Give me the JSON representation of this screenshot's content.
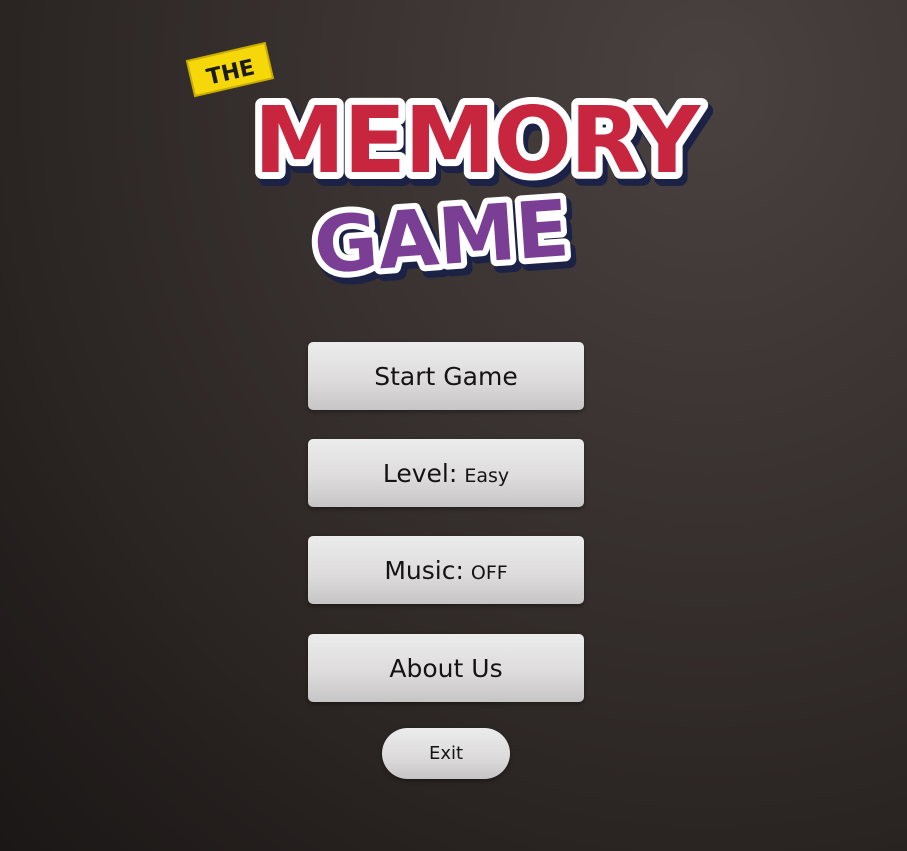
{
  "logo": {
    "the_text": "THE",
    "memory_text": "MEMORY",
    "game_text": "GAME"
  },
  "menu": {
    "start_label": "Start Game",
    "level_label": "Level:",
    "level_value": "Easy",
    "music_label": "Music:",
    "music_value": "OFF",
    "about_label": "About Us",
    "exit_label": "Exit"
  },
  "colors": {
    "memory_red": "#c8253f",
    "game_purple": "#7a3f94",
    "the_yellow": "#f6d80a",
    "button_light": "#e6e4e5"
  }
}
